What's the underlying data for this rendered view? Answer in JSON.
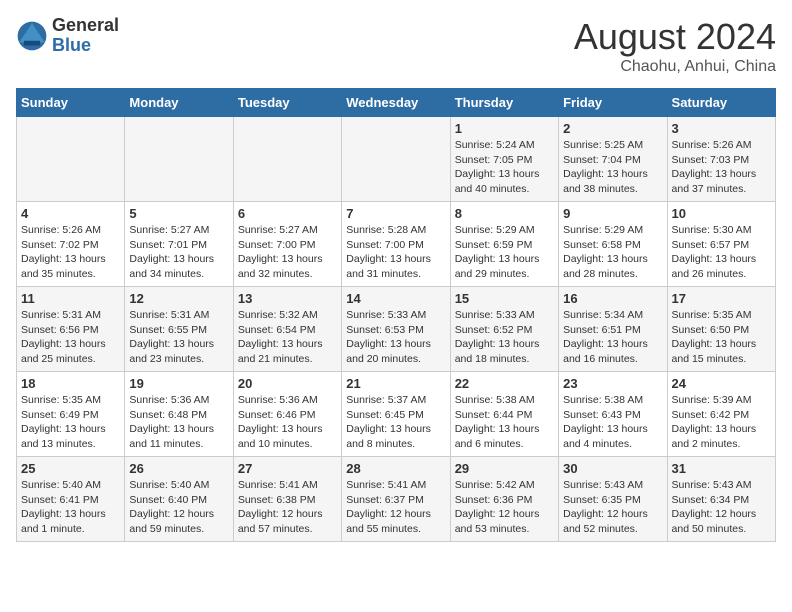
{
  "header": {
    "logo_general": "General",
    "logo_blue": "Blue",
    "title": "August 2024",
    "subtitle": "Chaohu, Anhui, China"
  },
  "weekdays": [
    "Sunday",
    "Monday",
    "Tuesday",
    "Wednesday",
    "Thursday",
    "Friday",
    "Saturday"
  ],
  "weeks": [
    [
      {
        "num": "",
        "info": ""
      },
      {
        "num": "",
        "info": ""
      },
      {
        "num": "",
        "info": ""
      },
      {
        "num": "",
        "info": ""
      },
      {
        "num": "1",
        "info": "Sunrise: 5:24 AM\nSunset: 7:05 PM\nDaylight: 13 hours\nand 40 minutes."
      },
      {
        "num": "2",
        "info": "Sunrise: 5:25 AM\nSunset: 7:04 PM\nDaylight: 13 hours\nand 38 minutes."
      },
      {
        "num": "3",
        "info": "Sunrise: 5:26 AM\nSunset: 7:03 PM\nDaylight: 13 hours\nand 37 minutes."
      }
    ],
    [
      {
        "num": "4",
        "info": "Sunrise: 5:26 AM\nSunset: 7:02 PM\nDaylight: 13 hours\nand 35 minutes."
      },
      {
        "num": "5",
        "info": "Sunrise: 5:27 AM\nSunset: 7:01 PM\nDaylight: 13 hours\nand 34 minutes."
      },
      {
        "num": "6",
        "info": "Sunrise: 5:27 AM\nSunset: 7:00 PM\nDaylight: 13 hours\nand 32 minutes."
      },
      {
        "num": "7",
        "info": "Sunrise: 5:28 AM\nSunset: 7:00 PM\nDaylight: 13 hours\nand 31 minutes."
      },
      {
        "num": "8",
        "info": "Sunrise: 5:29 AM\nSunset: 6:59 PM\nDaylight: 13 hours\nand 29 minutes."
      },
      {
        "num": "9",
        "info": "Sunrise: 5:29 AM\nSunset: 6:58 PM\nDaylight: 13 hours\nand 28 minutes."
      },
      {
        "num": "10",
        "info": "Sunrise: 5:30 AM\nSunset: 6:57 PM\nDaylight: 13 hours\nand 26 minutes."
      }
    ],
    [
      {
        "num": "11",
        "info": "Sunrise: 5:31 AM\nSunset: 6:56 PM\nDaylight: 13 hours\nand 25 minutes."
      },
      {
        "num": "12",
        "info": "Sunrise: 5:31 AM\nSunset: 6:55 PM\nDaylight: 13 hours\nand 23 minutes."
      },
      {
        "num": "13",
        "info": "Sunrise: 5:32 AM\nSunset: 6:54 PM\nDaylight: 13 hours\nand 21 minutes."
      },
      {
        "num": "14",
        "info": "Sunrise: 5:33 AM\nSunset: 6:53 PM\nDaylight: 13 hours\nand 20 minutes."
      },
      {
        "num": "15",
        "info": "Sunrise: 5:33 AM\nSunset: 6:52 PM\nDaylight: 13 hours\nand 18 minutes."
      },
      {
        "num": "16",
        "info": "Sunrise: 5:34 AM\nSunset: 6:51 PM\nDaylight: 13 hours\nand 16 minutes."
      },
      {
        "num": "17",
        "info": "Sunrise: 5:35 AM\nSunset: 6:50 PM\nDaylight: 13 hours\nand 15 minutes."
      }
    ],
    [
      {
        "num": "18",
        "info": "Sunrise: 5:35 AM\nSunset: 6:49 PM\nDaylight: 13 hours\nand 13 minutes."
      },
      {
        "num": "19",
        "info": "Sunrise: 5:36 AM\nSunset: 6:48 PM\nDaylight: 13 hours\nand 11 minutes."
      },
      {
        "num": "20",
        "info": "Sunrise: 5:36 AM\nSunset: 6:46 PM\nDaylight: 13 hours\nand 10 minutes."
      },
      {
        "num": "21",
        "info": "Sunrise: 5:37 AM\nSunset: 6:45 PM\nDaylight: 13 hours\nand 8 minutes."
      },
      {
        "num": "22",
        "info": "Sunrise: 5:38 AM\nSunset: 6:44 PM\nDaylight: 13 hours\nand 6 minutes."
      },
      {
        "num": "23",
        "info": "Sunrise: 5:38 AM\nSunset: 6:43 PM\nDaylight: 13 hours\nand 4 minutes."
      },
      {
        "num": "24",
        "info": "Sunrise: 5:39 AM\nSunset: 6:42 PM\nDaylight: 13 hours\nand 2 minutes."
      }
    ],
    [
      {
        "num": "25",
        "info": "Sunrise: 5:40 AM\nSunset: 6:41 PM\nDaylight: 13 hours\nand 1 minute."
      },
      {
        "num": "26",
        "info": "Sunrise: 5:40 AM\nSunset: 6:40 PM\nDaylight: 12 hours\nand 59 minutes."
      },
      {
        "num": "27",
        "info": "Sunrise: 5:41 AM\nSunset: 6:38 PM\nDaylight: 12 hours\nand 57 minutes."
      },
      {
        "num": "28",
        "info": "Sunrise: 5:41 AM\nSunset: 6:37 PM\nDaylight: 12 hours\nand 55 minutes."
      },
      {
        "num": "29",
        "info": "Sunrise: 5:42 AM\nSunset: 6:36 PM\nDaylight: 12 hours\nand 53 minutes."
      },
      {
        "num": "30",
        "info": "Sunrise: 5:43 AM\nSunset: 6:35 PM\nDaylight: 12 hours\nand 52 minutes."
      },
      {
        "num": "31",
        "info": "Sunrise: 5:43 AM\nSunset: 6:34 PM\nDaylight: 12 hours\nand 50 minutes."
      }
    ]
  ]
}
